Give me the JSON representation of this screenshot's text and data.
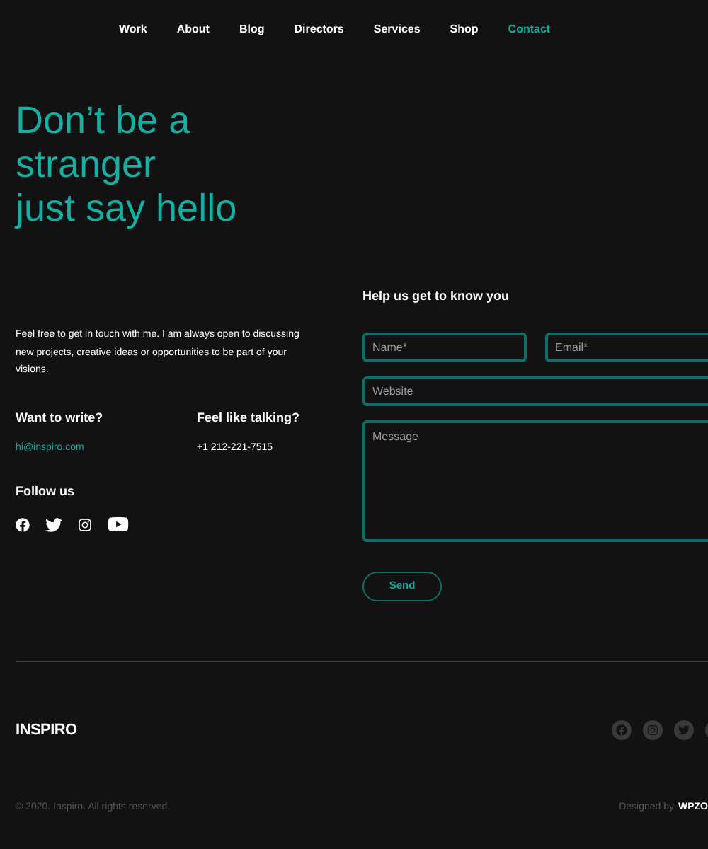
{
  "nav": [
    {
      "label": "Work",
      "selected": false
    },
    {
      "label": "About",
      "selected": false
    },
    {
      "label": "Blog",
      "selected": false
    },
    {
      "label": "Directors",
      "selected": false
    },
    {
      "label": "Services",
      "selected": false
    },
    {
      "label": "Shop",
      "selected": false
    },
    {
      "label": "Contact",
      "selected": true
    }
  ],
  "hero": {
    "lines": [
      "Don’t be a",
      "stranger",
      "just say hello"
    ]
  },
  "intro": "Feel free to get in touch with me. I am always open to discussing new projects, creative ideas or opportunities to be part of your visions.",
  "write": {
    "heading": "Want to write?",
    "email": "hi@inspiro.com"
  },
  "talk": {
    "heading": "Feel like talking?",
    "phone": "+1 212-221-7515"
  },
  "follow": {
    "heading": "Follow us"
  },
  "form": {
    "heading": "Help us get to know you",
    "name": {
      "placeholder": "Name*"
    },
    "email": {
      "placeholder": "Email*"
    },
    "website": {
      "placeholder": "Website"
    },
    "message": {
      "placeholder": "Message"
    },
    "submit": "Send"
  },
  "footer": {
    "logo": "INSPIRO",
    "copyright": "© 2020. Inspiro. All rights reserved.",
    "designed_by": "Designed by",
    "designer": "WPZO"
  }
}
